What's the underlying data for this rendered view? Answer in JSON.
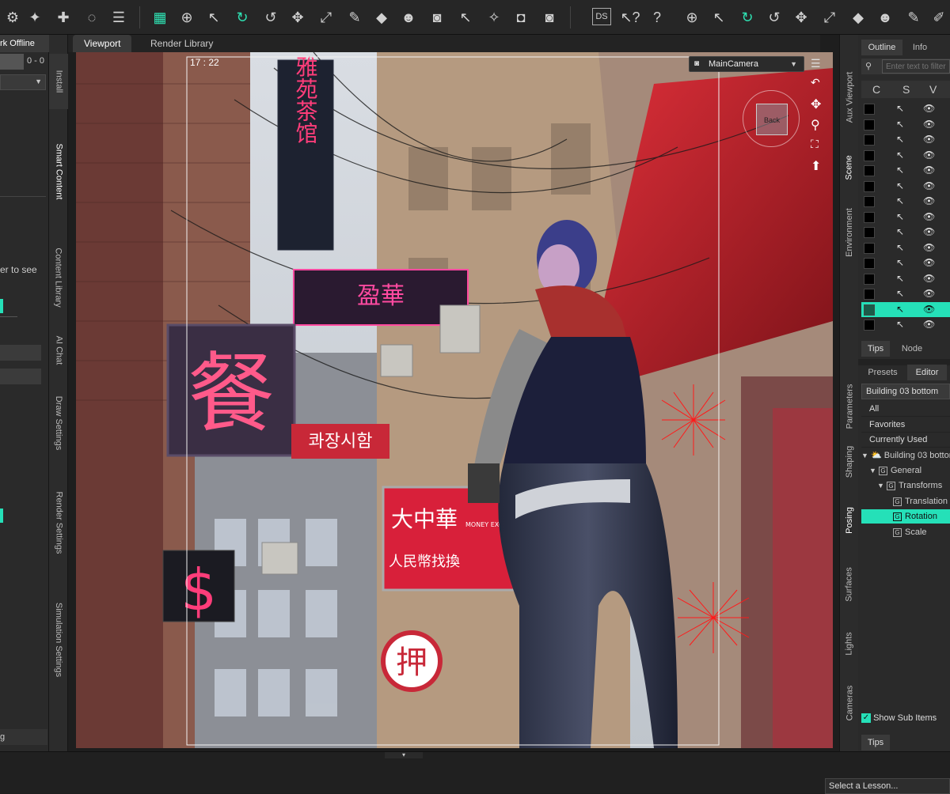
{
  "left_panel": {
    "header": "rk Offline",
    "counter": "0 - 0",
    "hint": "er to see",
    "footer_text": "g"
  },
  "left_tabs": [
    "Install",
    "Smart Content",
    "Content Library",
    "AI Chat",
    "Draw Settings",
    "Render Settings",
    "Simulation Settings"
  ],
  "viewport": {
    "tabs": [
      "Viewport",
      "Render Library"
    ],
    "timecode": "17 : 22",
    "camera": "MainCamera",
    "cube_label": "Back"
  },
  "right_tabs": [
    "Aux Viewport",
    "Scene",
    "Environment",
    "Parameters",
    "Shaping",
    "Posing",
    "Surfaces",
    "Lights",
    "Cameras"
  ],
  "scene_panel": {
    "tabs": [
      "Outline",
      "Info"
    ],
    "search_placeholder": "Enter text to filter",
    "columns": [
      "C",
      "S",
      "V"
    ],
    "bottom_tabs": [
      "Tips",
      "Node"
    ]
  },
  "params_panel": {
    "tabs": [
      "Presets",
      "Editor"
    ],
    "node_name": "Building 03 bottom",
    "categories": [
      "All",
      "Favorites",
      "Currently Used"
    ],
    "tree": {
      "root": "Building 03 bottom",
      "general": "General",
      "transforms": "Transforms",
      "leaves": [
        "Translation",
        "Rotation",
        "Scale"
      ]
    },
    "show_sub_items": "Show Sub Items",
    "tips": "Tips"
  },
  "statusbar": {
    "lesson": "Select a Lesson..."
  },
  "signs": {
    "sign1": "雅苑茶馆",
    "sign2": "盈華",
    "sign3": "餐",
    "sign4": "콰장시함",
    "sign5": "大中華",
    "sign5b": "MONEY EXCHANGE",
    "sign5c": "人民幣找換",
    "sign6": "$",
    "sign7": "押"
  },
  "colors": {
    "accent": "#25e0b8",
    "neon_pink": "#ff3d7a",
    "sign_red": "#d8203a"
  }
}
